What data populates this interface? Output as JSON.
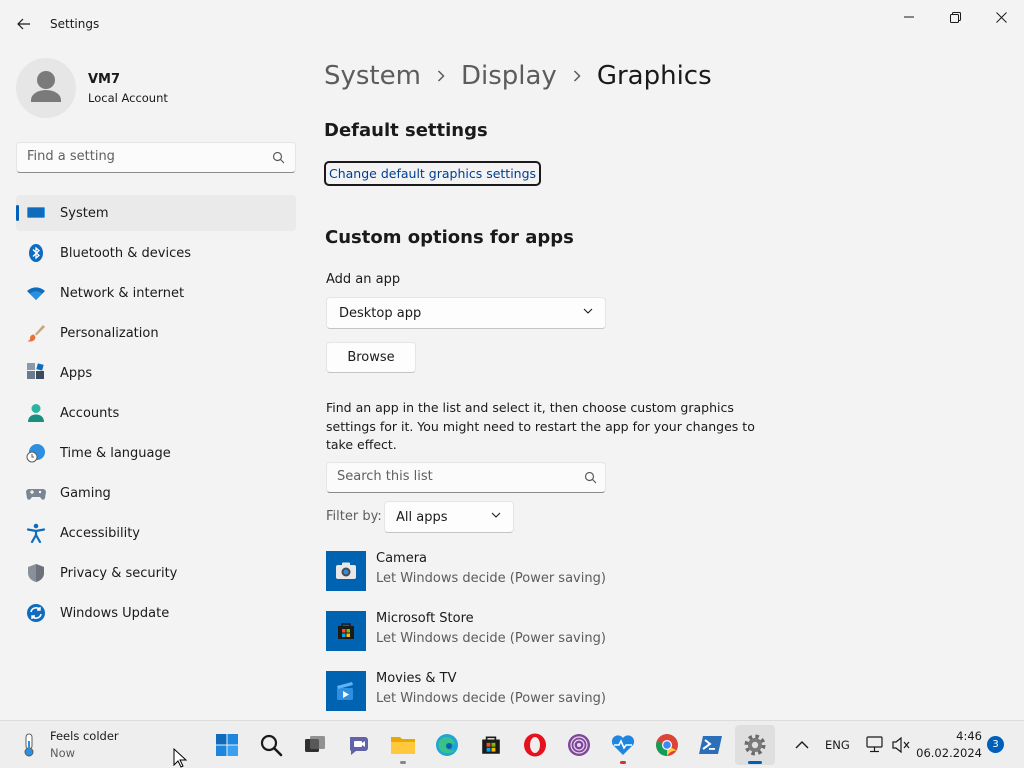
{
  "window": {
    "title": "Settings"
  },
  "profile": {
    "name": "VM7",
    "account_type": "Local Account"
  },
  "search": {
    "placeholder": "Find a setting"
  },
  "nav": {
    "items": [
      {
        "label": "System",
        "icon": "monitor-icon",
        "active": true
      },
      {
        "label": "Bluetooth & devices",
        "icon": "bluetooth-icon"
      },
      {
        "label": "Network & internet",
        "icon": "wifi-icon"
      },
      {
        "label": "Personalization",
        "icon": "brush-icon"
      },
      {
        "label": "Apps",
        "icon": "apps-icon"
      },
      {
        "label": "Accounts",
        "icon": "accounts-icon"
      },
      {
        "label": "Time & language",
        "icon": "globe-clock-icon"
      },
      {
        "label": "Gaming",
        "icon": "gamepad-icon"
      },
      {
        "label": "Accessibility",
        "icon": "accessibility-icon"
      },
      {
        "label": "Privacy & security",
        "icon": "shield-icon"
      },
      {
        "label": "Windows Update",
        "icon": "update-icon"
      }
    ]
  },
  "breadcrumb": {
    "level1": "System",
    "level2": "Display",
    "current": "Graphics"
  },
  "default_settings": {
    "heading": "Default settings",
    "link": "Change default graphics settings"
  },
  "custom_options": {
    "heading": "Custom options for apps",
    "add_app_label": "Add an app",
    "app_type_selected": "Desktop app",
    "browse_label": "Browse",
    "description": "Find an app in the list and select it, then choose custom graphics settings for it. You might need to restart the app for your changes to take effect.",
    "list_search_placeholder": "Search this list",
    "filter_label": "Filter by:",
    "filter_selected": "All apps"
  },
  "apps": [
    {
      "name": "Camera",
      "status": "Let Windows decide (Power saving)",
      "icon": "camera-icon"
    },
    {
      "name": "Microsoft Store",
      "status": "Let Windows decide (Power saving)",
      "icon": "store-icon"
    },
    {
      "name": "Movies & TV",
      "status": "Let Windows decide (Power saving)",
      "icon": "movies-icon"
    }
  ],
  "taskbar": {
    "weather_title": "Feels colder",
    "weather_sub": "Now",
    "language": "ENG",
    "time": "4:46",
    "date": "06.02.2024",
    "notification_count": "3"
  },
  "colors": {
    "accent": "#005fb8",
    "link": "#003e92",
    "app_tile": "#0063b1"
  }
}
